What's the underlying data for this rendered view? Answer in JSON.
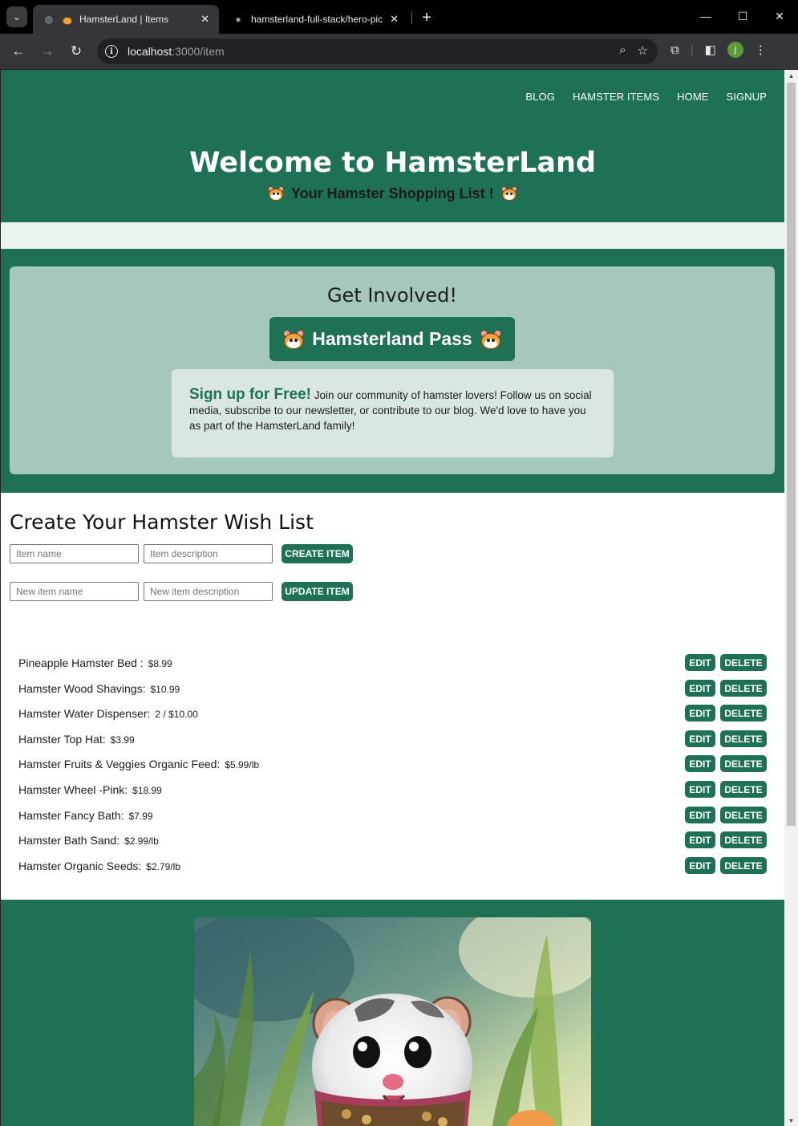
{
  "browser": {
    "tabs": [
      {
        "title": "HamsterLand | Items",
        "active": true
      },
      {
        "title": "hamsterland-full-stack/hero-pic",
        "active": false
      }
    ],
    "url_host": "localhost",
    "url_path": ":3000/item",
    "profile_initial": "j"
  },
  "nav": {
    "items": [
      "BLOG",
      "HAMSTER ITEMS",
      "HOME",
      "SIGNUP"
    ]
  },
  "hero": {
    "title": "Welcome to HamsterLand",
    "subtitle": "Your Hamster Shopping List !"
  },
  "involve": {
    "title": "Get Involved!",
    "pass_label": "Hamsterland Pass",
    "signup_heading": "Sign up for Free!",
    "signup_text": "Join our community of hamster lovers! Follow us on social media, subscribe to our newsletter, or contribute to our blog. We'd love to have you as part of the HamsterLand family!"
  },
  "wishlist": {
    "title": "Create Your Hamster Wish List",
    "item_name_placeholder": "Item name",
    "item_desc_placeholder": "Item description",
    "create_label": "CREATE ITEM",
    "new_name_placeholder": "New item name",
    "new_desc_placeholder": "New item description",
    "update_label": "UPDATE ITEM",
    "edit_label": "EDIT",
    "delete_label": "DELETE",
    "items": [
      {
        "name": "Pineapple Hamster Bed :",
        "price": "$8.99"
      },
      {
        "name": "Hamster Wood Shavings:",
        "price": "$10.99"
      },
      {
        "name": "Hamster Water Dispenser:",
        "price": "2 / $10.00"
      },
      {
        "name": "Hamster Top Hat:",
        "price": "$3.99"
      },
      {
        "name": "Hamster Fruits & Veggies Organic Feed:",
        "price": "$5.99/lb"
      },
      {
        "name": "Hamster Wheel -Pink:",
        "price": "$18.99"
      },
      {
        "name": "Hamster Fancy Bath:",
        "price": "$7.99"
      },
      {
        "name": "Hamster Bath Sand:",
        "price": "$2.99/lb"
      },
      {
        "name": "Hamster Organic Seeds:",
        "price": "$2.79/lb"
      }
    ]
  },
  "colors": {
    "brand_green": "#1e7155",
    "card_green": "#a5c8ba",
    "strip": "#ebf4ec"
  }
}
